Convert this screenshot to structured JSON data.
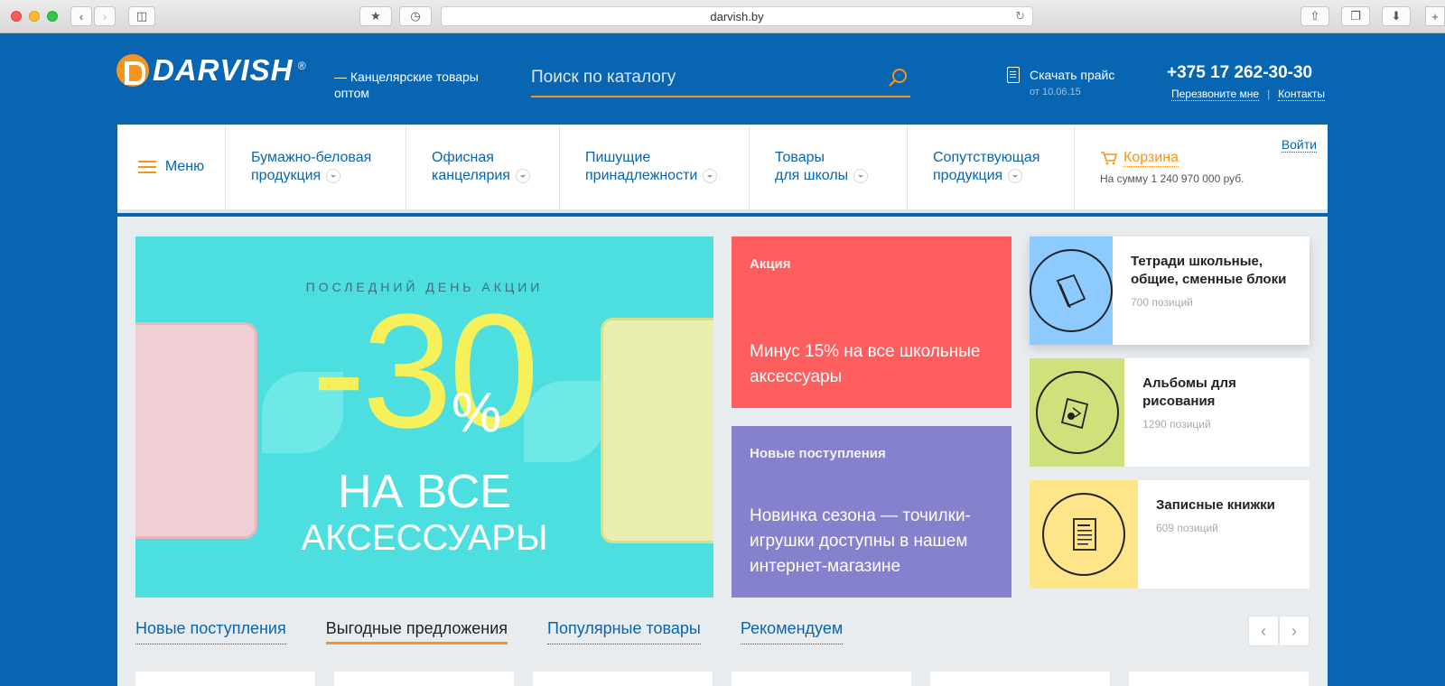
{
  "browser": {
    "url": "darvish.by"
  },
  "header": {
    "logo_text": "DARVISH",
    "logo_reg": "®",
    "tagline": "— Канцелярские товары оптом",
    "search_placeholder": "Поиск по каталогу",
    "price_label": "Скачать прайс",
    "price_date": "от 10.06.15",
    "phone": "+375 17 262-30-30",
    "callback_link": "Перезвоните мне",
    "contacts_link": "Контакты",
    "separator": "|"
  },
  "nav": {
    "menu_label": "Меню",
    "items": [
      {
        "line1": "Бумажно-беловая",
        "line2": "продукция"
      },
      {
        "line1": "Офисная",
        "line2": "канцелярия"
      },
      {
        "line1": "Пишущие",
        "line2": "принадлежности"
      },
      {
        "line1": "Товары",
        "line2": "для школы"
      },
      {
        "line1": "Сопутствующая",
        "line2": "продукция"
      }
    ],
    "cart_label": "Корзина",
    "cart_sum": "На сумму 1 240 970 000 руб.",
    "login_label": "Войти"
  },
  "banner": {
    "top_text": "ПОСЛЕДНИЙ ДЕНЬ АКЦИИ",
    "big_text": "-30",
    "percent": "%",
    "line1": "НА ВСЕ",
    "line2": "АКСЕССУАРЫ"
  },
  "promos": [
    {
      "label": "Акция",
      "text": "Минус 15% на все школьные аксессуары",
      "color": "#ff5e5e"
    },
    {
      "label": "Новые поступления",
      "text": "Новинка сезона — точилки-игрушки доступны в нашем интернет-магазине",
      "color": "#8681cc"
    }
  ],
  "categories": [
    {
      "name": "Тетради школьные, общие, сменные блоки",
      "count": "700 позиций",
      "color": "#8ccaff",
      "icon": "notebook-icon"
    },
    {
      "name": "Альбомы для рисования",
      "count": "1290 позиций",
      "color": "#cfe17a",
      "icon": "album-icon"
    },
    {
      "name": "Записные книжки",
      "count": "609 позиций",
      "color": "#ffe58a",
      "icon": "notepad-icon"
    }
  ],
  "tabs": [
    "Новые поступления",
    "Выгодные предложения",
    "Популярные товары",
    "Рекомендуем"
  ],
  "active_tab": 1,
  "colors": {
    "brand_blue": "#0865b2",
    "accent_orange": "#f7941d"
  }
}
